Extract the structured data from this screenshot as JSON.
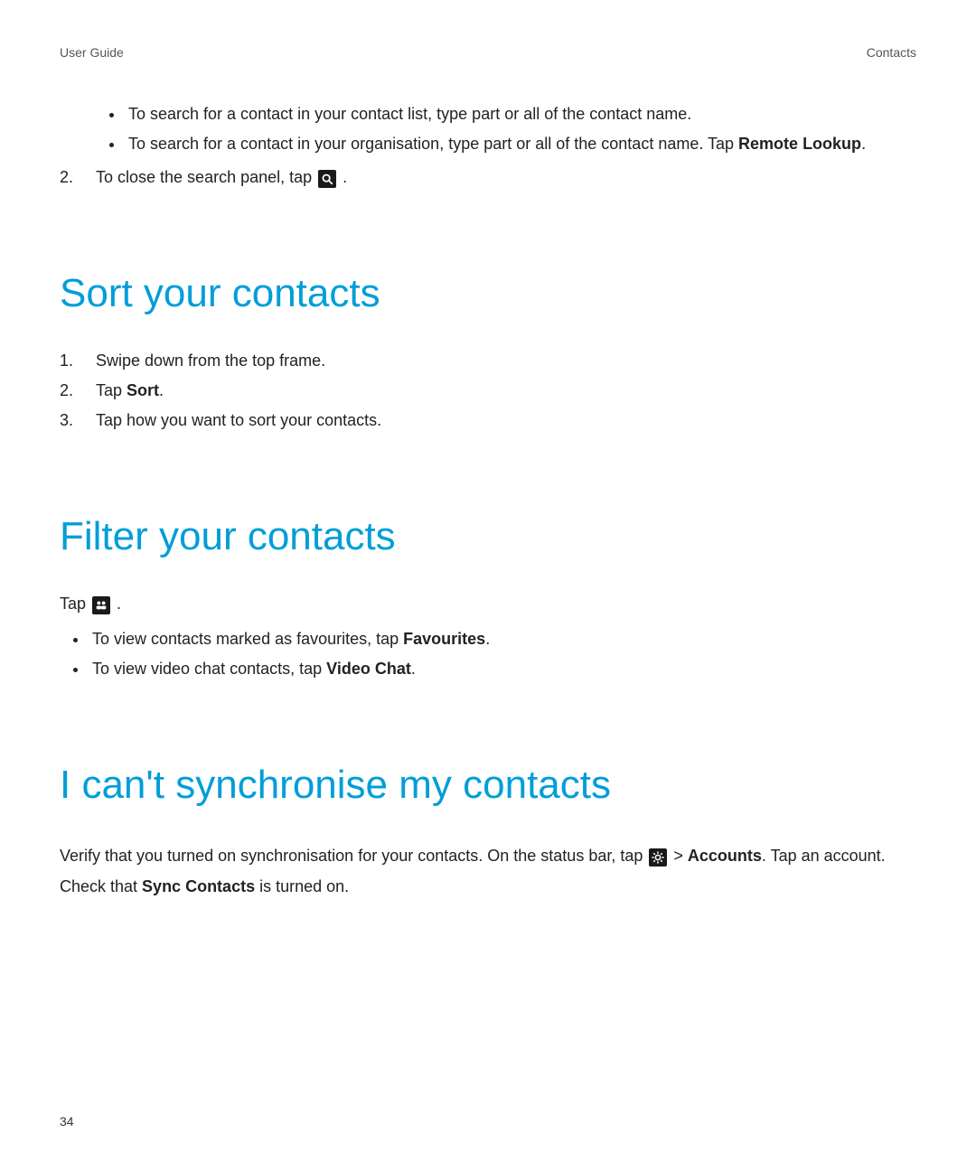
{
  "header": {
    "left": "User Guide",
    "right": "Contacts"
  },
  "intro": {
    "bullets": [
      "To search for a contact in your contact list, type part or all of the contact name.",
      {
        "prefix": "To search for a contact in your organisation, type part or all of the contact name. Tap ",
        "bold": "Remote Lookup",
        "suffix": "."
      }
    ],
    "step2": {
      "num": "2.",
      "prefix": "To close the search panel, tap ",
      "suffix": " ."
    }
  },
  "sort": {
    "heading": "Sort your contacts",
    "steps": [
      {
        "text": "Swipe down from the top frame."
      },
      {
        "prefix": "Tap ",
        "bold": "Sort",
        "suffix": "."
      },
      {
        "text": "Tap how you want to sort your contacts."
      }
    ]
  },
  "filter": {
    "heading": "Filter your contacts",
    "lead_prefix": "Tap ",
    "lead_suffix": " .",
    "bullets": [
      {
        "prefix": "To view contacts marked as favourites, tap ",
        "bold": "Favourites",
        "suffix": "."
      },
      {
        "prefix": "To view video chat contacts, tap ",
        "bold": "Video Chat",
        "suffix": "."
      }
    ]
  },
  "sync": {
    "heading": "I can't synchronise my contacts",
    "p1_prefix": "Verify that you turned on synchronisation for your contacts. On the status bar, tap ",
    "p1_gt": "  > ",
    "p1_bold1": "Accounts",
    "p1_mid": ". Tap an account. Check that ",
    "p1_bold2": "Sync Contacts",
    "p1_suffix": " is turned on."
  },
  "page_number": "34"
}
